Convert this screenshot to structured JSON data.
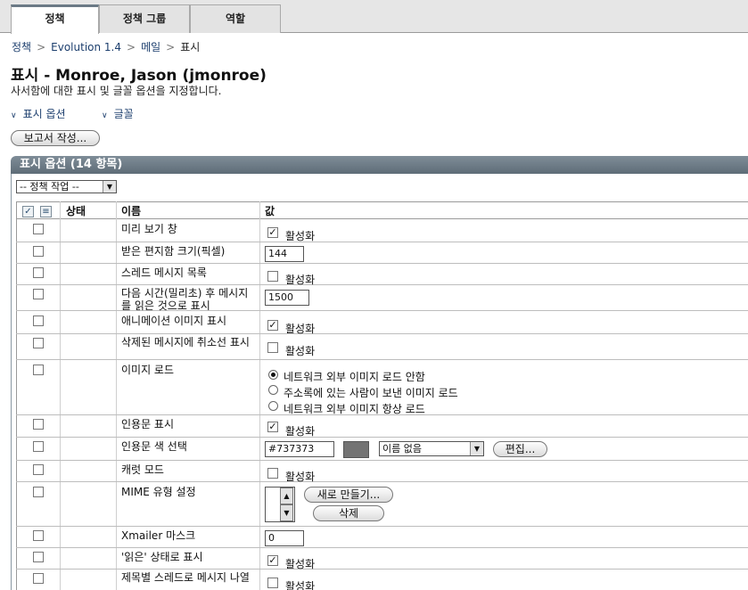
{
  "tabs": [
    {
      "label": "정책",
      "active": true
    },
    {
      "label": "정책 그룹",
      "active": false
    },
    {
      "label": "역할",
      "active": false
    }
  ],
  "breadcrumb": [
    "정책",
    "Evolution 1.4",
    "메일",
    "표시"
  ],
  "page": {
    "title": "표시 - Monroe, Jason (jmonroe)",
    "description": "사서함에 대한 표시 및 글꼴 옵션을 지정합니다."
  },
  "jump_links": [
    "표시 옵션",
    "글꼴"
  ],
  "report_button": "보고서 작성...",
  "section": {
    "title": "표시 옵션 (14 항목)",
    "action_select": "-- 정책 작업 --"
  },
  "table": {
    "headers": {
      "status": "상태",
      "name": "이름",
      "value": "값"
    },
    "enable_label": "활성화",
    "rows": [
      {
        "name": "미리 보기 창",
        "enabled": true
      },
      {
        "name": "받은 편지함 크기(픽셀)",
        "input": "144"
      },
      {
        "name": "스레드 메시지 목록",
        "enabled": false
      },
      {
        "name": "다음 시간(밀리초) 후 메시지를 읽은 것으로 표시",
        "input": "1500"
      },
      {
        "name": "애니메이션 이미지 표시",
        "enabled": true
      },
      {
        "name": "삭제된 메시지에 취소선 표시",
        "enabled": false
      },
      {
        "name": "이미지 로드",
        "radios": [
          "네트워크 외부 이미지 로드 안함",
          "주소록에 있는 사람이 보낸 이미지 로드",
          "네트워크 외부 이미지 항상 로드"
        ],
        "selected": 0
      },
      {
        "name": "인용문 표시",
        "enabled": true
      },
      {
        "name": "인용문 색 선택",
        "color": "#737373",
        "color_name": "이름 없음",
        "edit_button": "편집..."
      },
      {
        "name": "캐럿 모드",
        "enabled": false
      },
      {
        "name": "MIME 유형 설정",
        "new_button": "새로 만들기...",
        "delete_button": "삭제"
      },
      {
        "name": "Xmailer 마스크",
        "input": "0"
      },
      {
        "name": "'읽은' 상태로 표시",
        "enabled": true
      },
      {
        "name": "제목별 스레드로 메시지 나열",
        "enabled": false
      }
    ]
  },
  "colors": {
    "header": "#6b7a86",
    "link": "#1d3f6e",
    "swatch": "#737373"
  }
}
